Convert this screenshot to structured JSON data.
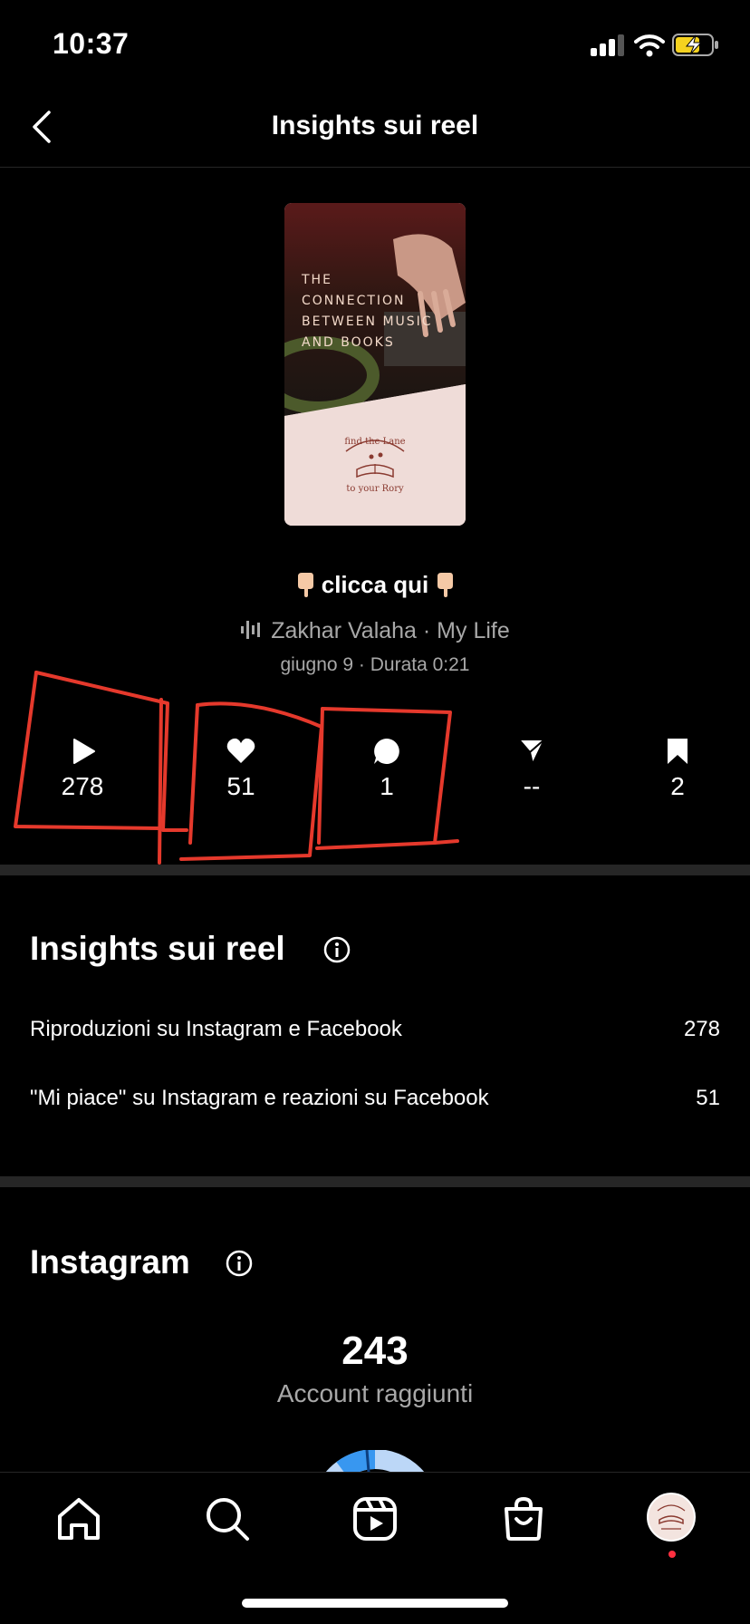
{
  "status_bar": {
    "time": "10:37"
  },
  "header": {
    "title": "Insights sui reel"
  },
  "reel": {
    "overlay_text": "THE\nCONNECTION\nBETWEEN MUSIC\nAND BOOKS",
    "logo_text": "find the Lane to your Rory",
    "caption": "clicca qui",
    "audio": "Zakhar Valaha · My Life",
    "date_duration": "giugno 9 · Durata 0:21"
  },
  "stats": [
    {
      "icon": "play-icon",
      "value": "278"
    },
    {
      "icon": "heart-icon",
      "value": "51"
    },
    {
      "icon": "comment-icon",
      "value": "1"
    },
    {
      "icon": "share-icon",
      "value": "--"
    },
    {
      "icon": "bookmark-icon",
      "value": "2"
    }
  ],
  "annotation_color": "#e5392c",
  "insights": {
    "title": "Insights sui reel",
    "rows": [
      {
        "label": "Riproduzioni su Instagram e Facebook",
        "value": "278"
      },
      {
        "label": "\"Mi piace\" su Instagram e reazioni su Facebook",
        "value": "51"
      }
    ]
  },
  "instagram": {
    "title": "Instagram",
    "accounts_reached": "243",
    "accounts_reached_label": "Account raggiunti"
  },
  "tab_bar": [
    "home-icon",
    "search-icon",
    "reels-icon",
    "shop-icon",
    "profile-avatar"
  ],
  "colors": {
    "background": "#000000",
    "accent": "#3897f0",
    "muted_text": "#a8a8a8",
    "divider": "#262626"
  }
}
